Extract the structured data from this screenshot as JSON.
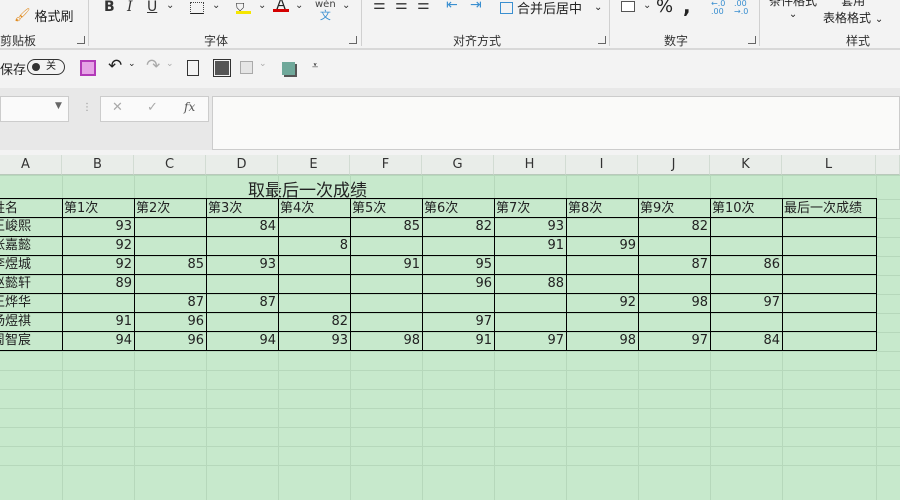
{
  "ribbon": {
    "format_painter": "格式刷",
    "groups": [
      "剪贴板",
      "字体",
      "对齐方式",
      "数字",
      "样式"
    ],
    "bold": "B",
    "italic": "I",
    "underline": "U",
    "merge_center": "合并后居中",
    "percent": "%",
    "comma": ",",
    "conditional_format": "条件格式",
    "table_format_top": "套用",
    "table_format": "表格格式",
    "phonetic_top": "wén",
    "phonetic": "文",
    "fill_color": "#f5e600",
    "font_color": "#d40000"
  },
  "quick_access": {
    "autosave_label": "保存",
    "autosave_toggle": "关"
  },
  "formula_bar": {
    "name_box": "",
    "cancel": "✕",
    "confirm": "✓",
    "fx": "fx",
    "formula": ""
  },
  "sheet": {
    "columns": [
      "A",
      "B",
      "C",
      "D",
      "E",
      "F",
      "G",
      "H",
      "I",
      "J",
      "K",
      "L"
    ],
    "title": "取最后一次成绩",
    "headers": [
      "姓名",
      "第1次",
      "第2次",
      "第3次",
      "第4次",
      "第5次",
      "第6次",
      "第7次",
      "第8次",
      "第9次",
      "第10次",
      "最后一次成绩"
    ],
    "rows": [
      [
        "王峻熙",
        "93",
        "",
        "84",
        "",
        "85",
        "82",
        "93",
        "",
        "82",
        "",
        ""
      ],
      [
        "张嘉懿",
        "92",
        "",
        "",
        "8",
        "",
        "",
        "91",
        "99",
        "",
        "",
        ""
      ],
      [
        "李煜城",
        "92",
        "85",
        "93",
        "",
        "91",
        "95",
        "",
        "",
        "87",
        "86",
        ""
      ],
      [
        "赵懿轩",
        "89",
        "",
        "",
        "",
        "",
        "96",
        "88",
        "",
        "",
        "",
        ""
      ],
      [
        "王烨华",
        "",
        "87",
        "87",
        "",
        "",
        "",
        "",
        "92",
        "98",
        "97",
        ""
      ],
      [
        "杨煜祺",
        "91",
        "96",
        "",
        "82",
        "",
        "97",
        "",
        "",
        "",
        "",
        ""
      ],
      [
        "周智宸",
        "94",
        "96",
        "94",
        "93",
        "98",
        "91",
        "97",
        "98",
        "97",
        "84",
        ""
      ]
    ]
  }
}
